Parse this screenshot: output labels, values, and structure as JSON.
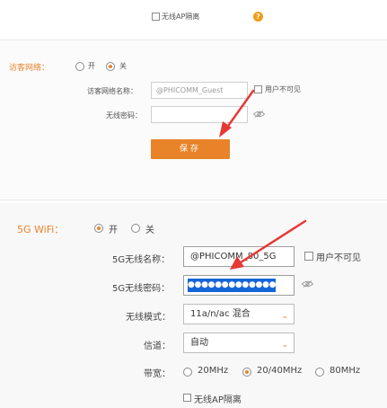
{
  "top": {
    "ap_isolation_label": "无线AP隔离",
    "help_glyph": "?"
  },
  "guest": {
    "title": "访客网络：",
    "on_label": "开",
    "off_label": "关",
    "enabled": false,
    "name_label": "访客网络名称：",
    "name_value": "@PHICOMM_Guest",
    "hide_label": "用户不可见",
    "password_label": "无线密码：",
    "password_value": "",
    "save_label": "保存"
  },
  "wifi5g": {
    "title": "5G WiFi：",
    "on_label": "开",
    "off_label": "关",
    "enabled": true,
    "name_label": "5G无线名称：",
    "name_value": "@PHICOMM_80_5G",
    "hide_label": "用户不可见",
    "password_label": "5G无线密码：",
    "password_value": "●●●●●●●●●●●●●●●",
    "mode_label": "无线模式：",
    "mode_value": "11a/n/ac 混合",
    "channel_label": "信道：",
    "channel_value": "自动",
    "bandwidth_label": "带宽：",
    "bandwidth_options": [
      "20MHz",
      "20/40MHz",
      "80MHz"
    ],
    "bandwidth_selected": "20/40MHz",
    "ap_isolation_label": "无线AP隔离"
  },
  "colors": {
    "accent": "#e8832a",
    "arrow": "#e53935",
    "selection": "#1565d8"
  },
  "icons": [
    "help-icon",
    "eye-icon",
    "chevron-down-icon",
    "arrow-annotation"
  ]
}
